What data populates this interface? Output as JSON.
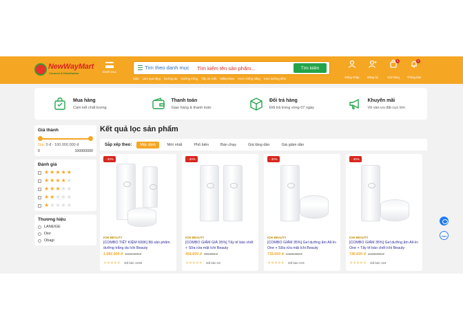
{
  "header": {
    "logo_text": "NewWayMart",
    "logo_sub": "Connect & Distribution",
    "menu_label": "Danh mục",
    "category_label": "Tìm theo danh mục",
    "search_placeholder": "Tìm kiếm tên sản phẩm...",
    "search_button": "Tìm kiếm",
    "quick_links": [
      "Sale",
      "Làm quà tặng",
      "Dưỡng da",
      "Dưỡng trắng",
      "Tẩy da chết",
      "Milk/yellow",
      "Kem chống nắng",
      "Kem dưỡng đêm"
    ],
    "actions": [
      {
        "label": "Đăng nhập",
        "icon": "user-icon"
      },
      {
        "label": "Đăng ký",
        "icon": "user-plus-icon"
      },
      {
        "label": "Giỏ hàng",
        "icon": "cart-icon",
        "badge": "0"
      },
      {
        "label": "Thông báo",
        "icon": "bell-icon",
        "badge": "0"
      }
    ],
    "color": "#f5a623"
  },
  "services": [
    {
      "title": "Mua hàng",
      "sub": "Cam kết chất lượng",
      "icon": "shopping-bag-icon"
    },
    {
      "title": "Thanh toán",
      "sub": "Giao hàng & thanh toán",
      "icon": "wallet-icon"
    },
    {
      "title": "Đổi trả hàng",
      "sub": "Đổi trả trong vòng 07 ngày",
      "icon": "box-return-icon"
    },
    {
      "title": "Khuyến mãi",
      "sub": "Vô vàn ưu đãi cực lớn",
      "icon": "megaphone-icon"
    }
  ],
  "sidebar": {
    "price_title": "Giá thành",
    "price_label": "Giá:",
    "price_range": "0 đ - 100.000.000 đ",
    "price_min": "0",
    "price_max": "100000000",
    "rating_title": "Đánh giá",
    "ratings": [
      5,
      4,
      3,
      2,
      1
    ],
    "brand_title": "Thương hiệu",
    "brands": [
      "LANEIGE",
      "Dior",
      "Obagi"
    ]
  },
  "main": {
    "title": "Kết quả lọc sản phẩm",
    "sort_label": "Sắp xếp theo:",
    "sort_options": [
      "Mặc định",
      "Mới nhất",
      "Phổ biến",
      "Bán chạy",
      "Giá tăng dần",
      "Giá giảm dần"
    ],
    "active_sort": "Mặc định"
  },
  "products": [
    {
      "discount": "- 30%",
      "brand": "ICHI BEAUTY",
      "name": "[COMBO TIẾT KIỆM 600K] Bộ sản phẩm dưỡng trắng da Ichi Beauty",
      "price": "1.082.900 đ",
      "old_price": "1.547.000 đ",
      "sold": "Đã bán 1036"
    },
    {
      "discount": "- 30%",
      "brand": "ICHI BEAUTY",
      "name": "[COMBO GIẢM GIÁ 35%] Tẩy tế bào chết + Sữa rửa mặt Ichi Beauty",
      "price": "491.650 đ",
      "old_price": "756.000 đ",
      "sold": "Đã bán 62"
    },
    {
      "discount": "- 30%",
      "brand": "ICHI BEAUTY",
      "name": "[COMBO GIẢM 35%] Gel dưỡng ẩm All-In-One + Sữa rửa mặt Ichi Beauty",
      "price": "733.600 đ",
      "old_price": "1.128.000 đ",
      "sold": "Đã bán 219"
    },
    {
      "discount": "- 30%",
      "brand": "ICHI BEAUTY",
      "name": "[COMBO GIẢM 35%] Gel dưỡng ẩm All-In-One + Tẩy tế bào chết Ichi Beauty",
      "price": "740.600 đ",
      "old_price": "1.139.000 đ",
      "sold": "Đã bán 118"
    }
  ],
  "floating": {
    "zalo_label": "Zalo"
  }
}
